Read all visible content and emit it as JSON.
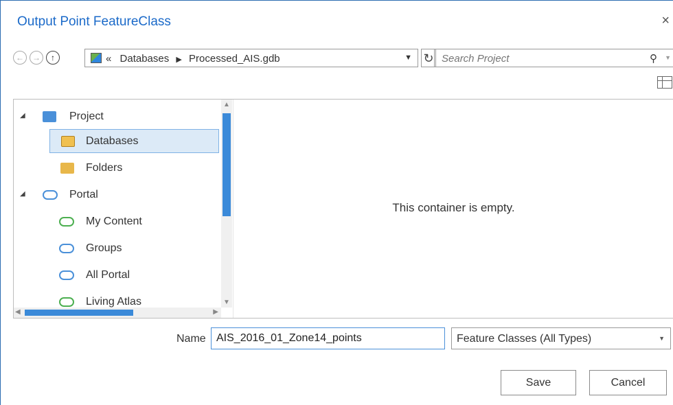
{
  "dialog": {
    "title": "Output Point FeatureClass",
    "close_glyph": "×"
  },
  "nav": {
    "back_glyph": "←",
    "forward_glyph": "→",
    "up_glyph": "↑",
    "overflow_glyph": "«",
    "breadcrumb": [
      "Databases",
      "Processed_AIS.gdb"
    ],
    "breadcrumb_sep": "▶",
    "dropdown_glyph": "▼",
    "refresh_glyph": "↻",
    "search_placeholder": "Search Project",
    "search_icon": "search-icon",
    "search_glyph": "⚲",
    "search_dropdown_glyph": "▼"
  },
  "tree": {
    "items": [
      {
        "label": "Project",
        "icon": "project-folder-icon",
        "expander": "◢"
      },
      {
        "label": "Databases",
        "icon": "database-folder-icon",
        "selected": true
      },
      {
        "label": "Folders",
        "icon": "folder-icon"
      },
      {
        "label": "Portal",
        "icon": "cloud-icon",
        "expander": "◢"
      },
      {
        "label": "My Content",
        "icon": "user-cloud-icon"
      },
      {
        "label": "Groups",
        "icon": "group-cloud-icon"
      },
      {
        "label": "All Portal",
        "icon": "cloud-icon"
      },
      {
        "label": "Living Atlas",
        "icon": "atlas-cloud-icon"
      }
    ]
  },
  "content": {
    "empty_message": "This container is empty."
  },
  "footer": {
    "name_label": "Name",
    "name_value": "AIS_2016_01_Zone14_points",
    "type_value": "Feature Classes (All Types)",
    "type_dropdown_glyph": "▼",
    "save_label": "Save",
    "cancel_label": "Cancel"
  },
  "colors": {
    "title": "#1b6ac9",
    "accent": "#3b8ad9",
    "selection_bg": "#dceaf7"
  }
}
